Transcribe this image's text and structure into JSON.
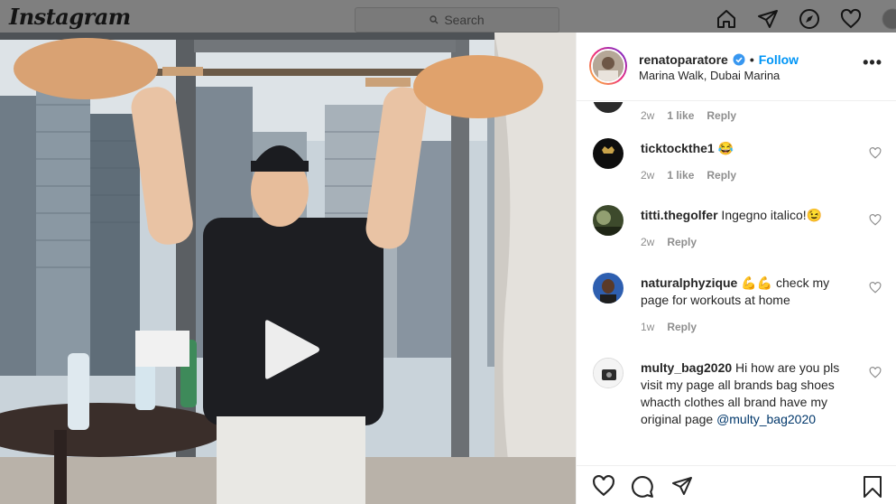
{
  "topbar": {
    "logo": "Instagram",
    "search_placeholder": "Search",
    "icons": [
      "home-icon",
      "direct-icon",
      "explore-icon",
      "activity-heart-icon",
      "profile-avatar"
    ]
  },
  "post": {
    "username": "renatoparatore",
    "separator": "•",
    "follow_label": "Follow",
    "location": "Marina Walk, Dubai Marina",
    "more_label": "•••"
  },
  "comments": [
    {
      "username": "",
      "text": "",
      "age": "2w",
      "likes": "1 like",
      "reply": "Reply"
    },
    {
      "username": "ticktockthe1",
      "text": " 😂",
      "age": "2w",
      "likes": "1 like",
      "reply": "Reply"
    },
    {
      "username": "titti.thegolfer",
      "text": " Ingegno italico!😉",
      "age": "2w",
      "likes": "",
      "reply": "Reply"
    },
    {
      "username": "naturalphyzique",
      "text": " 💪💪 check my page for workouts at home",
      "age": "1w",
      "likes": "",
      "reply": "Reply"
    },
    {
      "username": "multy_bag2020",
      "text": " Hi how are you pls visit my page all brands bag shoes whacth clothes all brand have my original page ",
      "mention": "@multy_bag2020",
      "age": "",
      "likes": "",
      "reply": ""
    }
  ],
  "colors": {
    "follow": "#0095f6",
    "meta": "#8e8e8e",
    "text": "#262626",
    "mention": "#00376b"
  }
}
